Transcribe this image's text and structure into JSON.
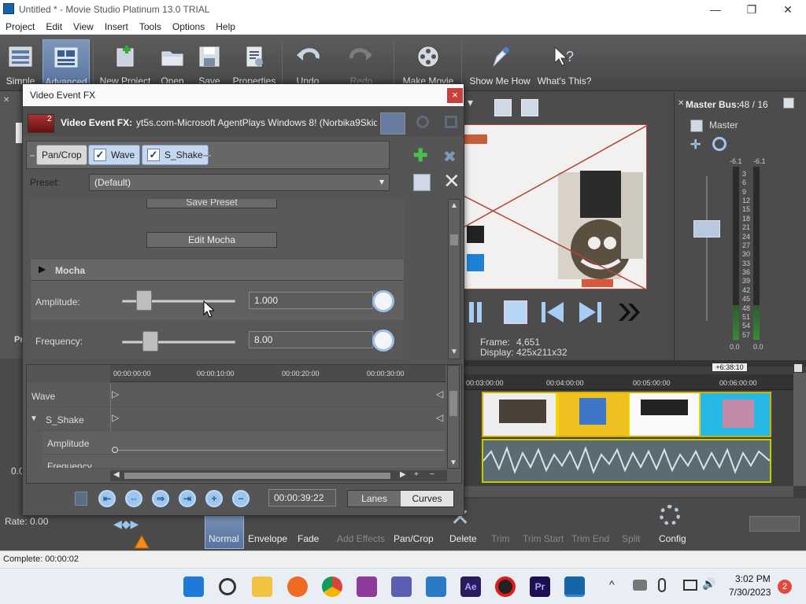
{
  "window": {
    "title": "Untitled * - Movie Studio Platinum 13.0 TRIAL"
  },
  "menu": [
    "Project",
    "Edit",
    "View",
    "Insert",
    "Tools",
    "Options",
    "Help"
  ],
  "toolbar": {
    "simple": "Simple",
    "advanced": "Advanced",
    "new_project": "New Project",
    "open": "Open",
    "save": "Save",
    "properties": "Properties",
    "undo": "Undo",
    "redo": "Redo",
    "make_movie": "Make Movie",
    "show_me_how": "Show Me How",
    "whats_this": "What's This?"
  },
  "dialog": {
    "title": "Video Event FX",
    "close": "×",
    "badge": "2",
    "header_label": "Video Event FX:",
    "header_file": "yt5s.com-Microsoft AgentPlays Windows 8! (Norbika9Skid's'",
    "chain": [
      "Pan/Crop",
      "Wave",
      "S_Shake"
    ],
    "preset_label": "Preset:",
    "preset_value": "(Default)",
    "save_preset": "Save Preset",
    "edit_mocha": "Edit Mocha",
    "mocha_section": "Mocha",
    "amplitude_label": "Amplitude:",
    "amplitude_value": "1.000",
    "frequency_label": "Frequency:",
    "frequency_value": "8.00",
    "ruler": [
      "00:00:00:00",
      "00:00:10:00",
      "00:00:20:00",
      "00:00:30:00"
    ],
    "tracks": [
      {
        "label": "Wave"
      },
      {
        "label": "S_Shake"
      },
      {
        "label": "Amplitude"
      },
      {
        "label": "Frequency"
      }
    ],
    "timecode": "00:00:39:22",
    "lanes": "Lanes",
    "curves": "Curves"
  },
  "preview": {
    "frame_label": "Frame:",
    "frame_value": "4,651",
    "display_label": "Display:",
    "display_value": "425x211x32"
  },
  "masterbus": {
    "title": "Master Bus:",
    "value": "48 / 16",
    "master_label": "Master",
    "db_left": "-6.1",
    "db_right": "-6.1",
    "scale": [
      "3",
      "6",
      "9",
      "12",
      "15",
      "18",
      "21",
      "24",
      "27",
      "30",
      "33",
      "36",
      "39",
      "42",
      "45",
      "48",
      "51",
      "54",
      "57"
    ],
    "bottom_left": "0.0",
    "bottom_right": "0.0"
  },
  "timeline": {
    "marker": "+6:38:10",
    "ruler": [
      "00:03:00:00",
      "00:04:00:00",
      "00:05:00:00",
      "00:06:00:00"
    ]
  },
  "bottom": {
    "rate": "Rate: 0.00",
    "normal": "Normal",
    "envelope": "Envelope",
    "fade": "Fade",
    "add_effects": "Add Effects",
    "pan_crop": "Pan/Crop",
    "delete": "Delete",
    "trim": "Trim",
    "trim_start": "Trim Start",
    "trim_end": "Trim End",
    "split": "Split",
    "config": "Config",
    "left_value": "0.0",
    "left_label_pr": "Pr"
  },
  "status": {
    "complete": "Complete: 00:00:02"
  },
  "taskbar": {
    "time": "3:02 PM",
    "date": "7/30/2023",
    "notif": "2"
  }
}
